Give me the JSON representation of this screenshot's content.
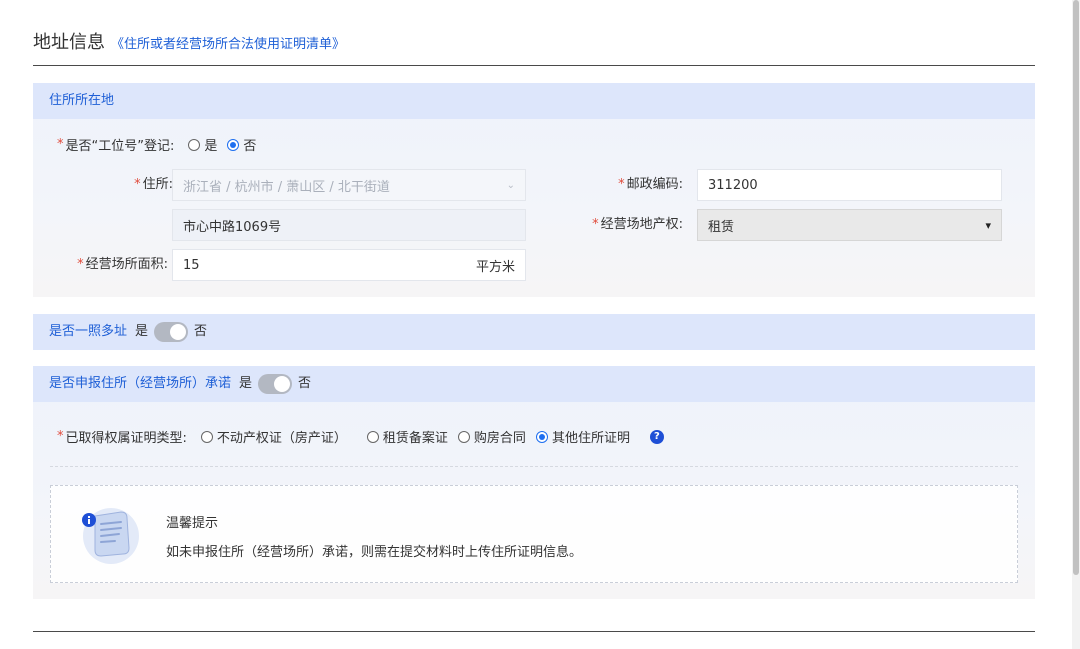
{
  "header": {
    "title": "地址信息",
    "link": "《住所或者经营场所合法使用证明清单》"
  },
  "section_residence": {
    "title": "住所所在地",
    "workstation_label": "是否“工位号”登记:",
    "workstation_options": [
      "是",
      "否"
    ],
    "workstation_selected": "否",
    "address_label": "住所:",
    "address_placeholder": "浙江省 / 杭州市 / 萧山区 / 北干街道",
    "street_value": "市心中路1069号",
    "postal_label": "邮政编码:",
    "postal_value": "311200",
    "property_label": "经营场地产权:",
    "property_value": "租赁",
    "area_label": "经营场所面积:",
    "area_value": "15",
    "area_unit": "平方米"
  },
  "section_multi": {
    "title": "是否一照多址",
    "yes": "是",
    "no": "否"
  },
  "section_commit": {
    "title": "是否申报住所（经营场所）承诺",
    "yes": "是",
    "no": "否",
    "cert_label": "已取得权属证明类型:",
    "cert_options": [
      "不动产权证（房产证）",
      "租赁备案证",
      "购房合同",
      "其他住所证明"
    ],
    "cert_selected": "其他住所证明",
    "help_glyph": "?",
    "tip_title": "温馨提示",
    "tip_text": "如未申报住所（经营场所）承诺，则需在提交材料时上传住所证明信息。"
  },
  "colors": {
    "accent": "#1e5fd6",
    "panel_header": "#dde6fb",
    "required": "#e04a3a",
    "radio_checked": "#1e6ff0"
  }
}
